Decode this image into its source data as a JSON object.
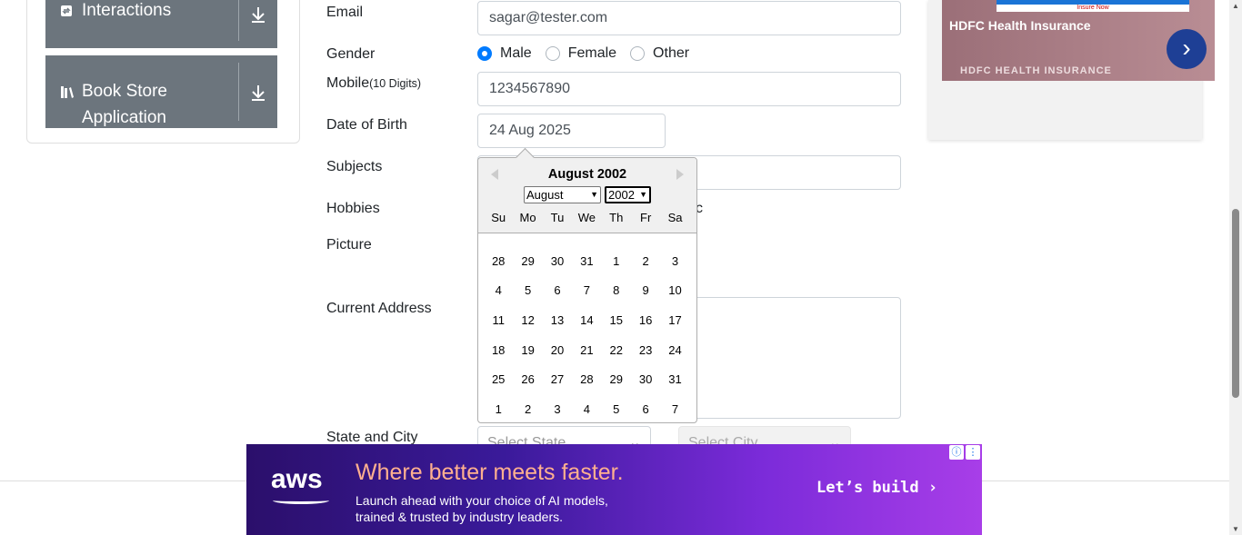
{
  "sidebar": {
    "groups": [
      {
        "label": "Interactions",
        "icon": "interactions-icon"
      },
      {
        "label": "Book Store Application",
        "line1": "Book Store",
        "line2": "Application",
        "icon": "books-icon"
      }
    ]
  },
  "form": {
    "email_label": "Email",
    "email_value": "sagar@tester.com",
    "gender_label": "Gender",
    "gender_options": [
      "Male",
      "Female",
      "Other"
    ],
    "gender_selected": "Male",
    "mobile_label": "Mobile",
    "mobile_hint": "(10 Digits)",
    "mobile_value": "1234567890",
    "dob_label": "Date of Birth",
    "dob_value": "24 Aug 2025",
    "subjects_label": "Subjects",
    "hobbies_label": "Hobbies",
    "hobbies_partial": "c",
    "picture_label": "Picture",
    "address_label": "Current Address",
    "state_city_label": "State and City",
    "state_placeholder": "Select State",
    "city_placeholder": "Select City"
  },
  "datepicker": {
    "title": "August 2002",
    "month_select": "August",
    "year_select": "2002",
    "weekdays": [
      "Su",
      "Mo",
      "Tu",
      "We",
      "Th",
      "Fr",
      "Sa"
    ],
    "weeks": [
      [
        "28",
        "29",
        "30",
        "31",
        "1",
        "2",
        "3"
      ],
      [
        "4",
        "5",
        "6",
        "7",
        "8",
        "9",
        "10"
      ],
      [
        "11",
        "12",
        "13",
        "14",
        "15",
        "16",
        "17"
      ],
      [
        "18",
        "19",
        "20",
        "21",
        "22",
        "23",
        "24"
      ],
      [
        "25",
        "26",
        "27",
        "28",
        "29",
        "30",
        "31"
      ],
      [
        "1",
        "2",
        "3",
        "4",
        "5",
        "6",
        "7"
      ]
    ]
  },
  "ad_top": {
    "strip_text": "Insure Now",
    "title": "HDFC Health Insurance",
    "subtitle": "HDFC HEALTH INSURANCE"
  },
  "ad_bottom": {
    "logo": "aws",
    "headline": "Where better meets faster.",
    "body_line1": "Launch ahead with your choice of AI models,",
    "body_line2": "trained & trusted by industry leaders.",
    "cta": "Let’s build ›"
  },
  "colors": {
    "accent": "#007bff",
    "sidebar_group": "#6c757d"
  }
}
